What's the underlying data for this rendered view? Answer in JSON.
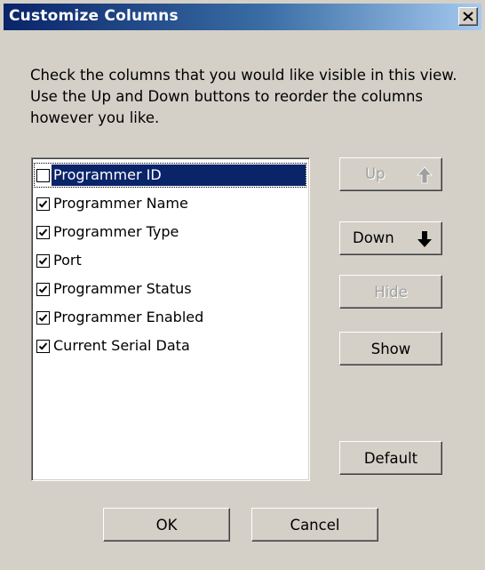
{
  "dialog": {
    "title": "Customize Columns",
    "instructions": "Check the columns that you would like visible in this view. Use the Up and Down buttons to reorder the columns however you like."
  },
  "columns": [
    {
      "label": "Programmer ID",
      "checked": false,
      "selected": true
    },
    {
      "label": "Programmer Name",
      "checked": true,
      "selected": false
    },
    {
      "label": "Programmer Type",
      "checked": true,
      "selected": false
    },
    {
      "label": "Port",
      "checked": true,
      "selected": false
    },
    {
      "label": "Programmer Status",
      "checked": true,
      "selected": false
    },
    {
      "label": "Programmer Enabled",
      "checked": true,
      "selected": false
    },
    {
      "label": "Current Serial Data",
      "checked": true,
      "selected": false
    }
  ],
  "buttons": {
    "up": {
      "label": "Up",
      "enabled": false,
      "icon": "arrow-up-icon"
    },
    "down": {
      "label": "Down",
      "enabled": true,
      "icon": "arrow-down-icon"
    },
    "hide": {
      "label": "Hide",
      "enabled": false
    },
    "show": {
      "label": "Show",
      "enabled": true
    },
    "default": {
      "label": "Default",
      "enabled": true
    },
    "ok": {
      "label": "OK",
      "enabled": true
    },
    "cancel": {
      "label": "Cancel",
      "enabled": true
    }
  },
  "colors": {
    "title_gradient_start": "#0a246a",
    "title_gradient_end": "#a6caf0",
    "dialog_background": "#d4d0c8",
    "selection": "#0a246a"
  }
}
